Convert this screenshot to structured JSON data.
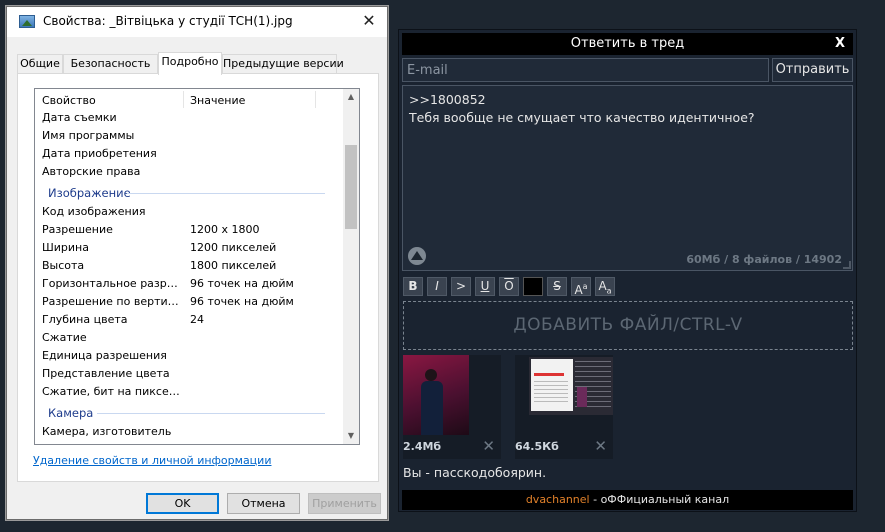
{
  "dialog": {
    "title": "Свойства: _Вітвіцька у студії ТСН(1).jpg",
    "close_glyph": "✕",
    "tabs": [
      {
        "label": "Общие"
      },
      {
        "label": "Безопасность"
      },
      {
        "label": "Подробно"
      },
      {
        "label": "Предыдущие версии"
      }
    ],
    "active_tab": "Подробно",
    "columns": {
      "property": "Свойство",
      "value": "Значение"
    },
    "rows_top": [
      {
        "key": "Дата съемки",
        "value": ""
      },
      {
        "key": "Имя программы",
        "value": ""
      },
      {
        "key": "Дата приобретения",
        "value": ""
      },
      {
        "key": "Авторские права",
        "value": ""
      }
    ],
    "group_image": "Изображение",
    "rows_image": [
      {
        "key": "Код изображения",
        "value": ""
      },
      {
        "key": "Разрешение",
        "value": "1200 x 1800"
      },
      {
        "key": "Ширина",
        "value": "1200 пикселей"
      },
      {
        "key": "Высота",
        "value": "1800 пикселей"
      },
      {
        "key": "Горизонтальное разреше...",
        "value": "96 точек на дюйм"
      },
      {
        "key": "Разрешение по вертикали",
        "value": "96 точек на дюйм"
      },
      {
        "key": "Глубина цвета",
        "value": "24"
      },
      {
        "key": "Сжатие",
        "value": ""
      },
      {
        "key": "Единица разрешения",
        "value": ""
      },
      {
        "key": "Представление цвета",
        "value": ""
      },
      {
        "key": "Сжатие, бит на пиксель",
        "value": ""
      }
    ],
    "group_camera": "Камера",
    "rows_camera": [
      {
        "key": "Камера, изготовитель",
        "value": ""
      }
    ],
    "remove_link": "Удаление свойств и личной информации",
    "buttons": {
      "ok": "OK",
      "cancel": "Отмена",
      "apply": "Применить"
    }
  },
  "reply": {
    "header": "Ответить в тред",
    "close_label": "X",
    "email_placeholder": "E-mail",
    "send_label": "Отправить",
    "message_lines": [
      ">>1800852",
      "Тебя вообще не смущает что качество идентичное?"
    ],
    "counter": "60Мб / 8 файлов / 14902",
    "format_buttons": [
      {
        "label": "B"
      },
      {
        "label": "I"
      },
      {
        "label": ">"
      },
      {
        "label": "U"
      },
      {
        "label": "O"
      },
      {
        "label": ""
      },
      {
        "label": "S"
      },
      {
        "label": "A",
        "mark": "a"
      },
      {
        "label": "A",
        "mark": "a"
      }
    ],
    "dropzone": "ДОБАВИТЬ ФАЙЛ/CTRL-V",
    "files": [
      {
        "size": "2.4Мб"
      },
      {
        "size": "64.5Кб"
      }
    ],
    "remove_glyph": "✕",
    "caption": "Вы - пасскодобоярин.",
    "footer_brand": "dvachannel",
    "footer_sep": " - ",
    "footer_text": "оФФициальный канал"
  },
  "colors": {
    "page_bg": "#1d2630",
    "link": "#0066cc",
    "group_heading": "#1e3c8c",
    "brand_orange": "#e0802a"
  }
}
